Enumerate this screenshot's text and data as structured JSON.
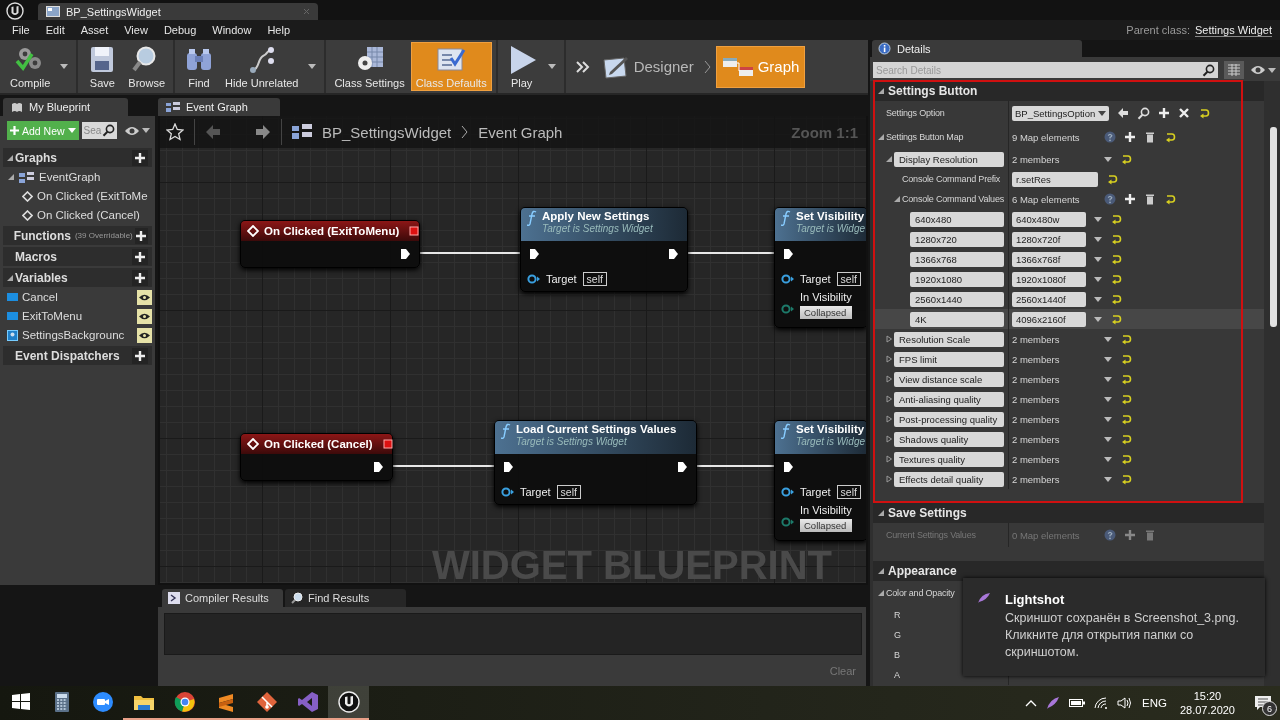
{
  "title_bar": {
    "tab": "BP_SettingsWidget"
  },
  "menu": [
    "File",
    "Edit",
    "Asset",
    "View",
    "Debug",
    "Window",
    "Help"
  ],
  "parent_class": {
    "label": "Parent class:",
    "value": "Settings Widget"
  },
  "toolbar": [
    [
      {
        "kind": "compile",
        "label": "Compile",
        "dropdown": true,
        "selected": false
      }
    ],
    [
      {
        "kind": "save",
        "label": "Save",
        "dropdown": false,
        "selected": false
      },
      {
        "kind": "browse",
        "label": "Browse",
        "dropdown": false,
        "selected": false
      }
    ],
    [
      {
        "kind": "find",
        "label": "Find",
        "dropdown": false,
        "selected": false
      },
      {
        "kind": "hide-unrelated",
        "label": "Hide Unrelated",
        "dropdown": true,
        "selected": false
      }
    ],
    [
      {
        "kind": "class-settings",
        "label": "Class Settings",
        "dropdown": false,
        "selected": false
      },
      {
        "kind": "class-defaults",
        "label": "Class Defaults",
        "dropdown": false,
        "selected": true
      }
    ],
    [
      {
        "kind": "play",
        "label": "Play",
        "dropdown": true,
        "selected": false
      }
    ]
  ],
  "modes": [
    {
      "kind": "designer",
      "label": "Designer",
      "selected": false
    },
    {
      "kind": "graph",
      "label": "Graph",
      "selected": true
    }
  ],
  "my_blueprint": {
    "tab": "My Blueprint",
    "add_button": "Add New",
    "search_placeholder": "Sea",
    "sections": [
      {
        "title": "Graphs",
        "expanded": true,
        "items": [
          {
            "kind": "graph",
            "label": "EventGraph",
            "expanded": true,
            "children": [
              {
                "kind": "event",
                "label": "On Clicked (ExitToMe"
              },
              {
                "kind": "event",
                "label": "On Clicked (Cancel)"
              }
            ]
          }
        ]
      },
      {
        "title": "Functions",
        "note": "(39 Overridable)",
        "expanded": false
      },
      {
        "title": "Macros",
        "expanded": false
      },
      {
        "title": "Variables",
        "expanded": true,
        "items": [
          {
            "kind": "variable",
            "label": "Cancel",
            "exposed": true
          },
          {
            "kind": "variable",
            "label": "ExitToMenu",
            "exposed": true
          },
          {
            "kind": "image-variable",
            "label": "SettingsBackgrounc",
            "exposed": true
          }
        ]
      },
      {
        "title": "Event Dispatchers",
        "expanded": false
      }
    ]
  },
  "graph": {
    "tab": "Event Graph",
    "breadcrumb": [
      "BP_SettingsWidget",
      "Event Graph"
    ],
    "zoom": "Zoom 1:1",
    "watermark": "WIDGET BLUEPRINT",
    "chains": [
      [
        {
          "kind": "event",
          "title": "On Clicked (ExitToMenu)"
        },
        {
          "kind": "function",
          "title": "Apply New Settings",
          "subtitle": "Target is Settings Widget",
          "inputs": [
            {
              "kind": "object",
              "label": "Target",
              "value": "self"
            }
          ]
        },
        {
          "kind": "function",
          "title": "Set Visibility",
          "subtitle": "Target is Widge",
          "inputs": [
            {
              "kind": "object",
              "label": "Target",
              "value": "self"
            },
            {
              "kind": "enum",
              "label": "In Visibility",
              "value": "Collapsed"
            }
          ]
        }
      ],
      [
        {
          "kind": "event",
          "title": "On Clicked (Cancel)"
        },
        {
          "kind": "function",
          "title": "Load Current Settings Values",
          "subtitle": "Target is Settings Widget",
          "inputs": [
            {
              "kind": "object",
              "label": "Target",
              "value": "self"
            }
          ]
        },
        {
          "kind": "function",
          "title": "Set Visibility",
          "subtitle": "Target is Widge",
          "inputs": [
            {
              "kind": "object",
              "label": "Target",
              "value": "self"
            },
            {
              "kind": "enum",
              "label": "In Visibility",
              "value": "Collapsed"
            }
          ]
        }
      ]
    ]
  },
  "results": {
    "tabs": [
      {
        "label": "Compiler Results",
        "selected": true
      },
      {
        "label": "Find Results",
        "selected": false
      }
    ],
    "clear": {
      "label": "Clear",
      "disabled": true
    }
  },
  "details": {
    "tab": "Details",
    "search_placeholder": "Search Details",
    "sections": [
      {
        "title": "Settings Button",
        "expanded": true,
        "rows": [
          {
            "kind": "object",
            "label": "Settings Option",
            "value": "BP_SettingsOption"
          },
          {
            "kind": "map",
            "label": "Settings Button Map",
            "value": "9 Map elements",
            "disabled": false,
            "expanded": true,
            "children": [
              {
                "kind": "struct",
                "label": "Display Resolution",
                "value": "2 members",
                "expanded": true,
                "children": [
                  {
                    "kind": "text",
                    "label": "Console Command Prefix",
                    "value": "r.setRes"
                  },
                  {
                    "kind": "map",
                    "label": "Console Command Values",
                    "value": "6 Map elements",
                    "disabled": false,
                    "expanded": true,
                    "children": [
                      {
                        "kind": "pair",
                        "label": "640x480",
                        "value": "640x480w",
                        "selected": false
                      },
                      {
                        "kind": "pair",
                        "label": "1280x720",
                        "value": "1280x720f",
                        "selected": false
                      },
                      {
                        "kind": "pair",
                        "label": "1366x768",
                        "value": "1366x768f",
                        "selected": false
                      },
                      {
                        "kind": "pair",
                        "label": "1920x1080",
                        "value": "1920x1080f",
                        "selected": false
                      },
                      {
                        "kind": "pair",
                        "label": "2560x1440",
                        "value": "2560x1440f",
                        "selected": false
                      },
                      {
                        "kind": "pair",
                        "label": "4K",
                        "value": "4096x2160f",
                        "selected": true
                      }
                    ]
                  }
                ]
              },
              {
                "kind": "struct",
                "label": "Resolution Scale",
                "value": "2 members",
                "expanded": false
              },
              {
                "kind": "struct",
                "label": "FPS limit",
                "value": "2 members",
                "expanded": false
              },
              {
                "kind": "struct",
                "label": "View distance scale",
                "value": "2 members",
                "expanded": false
              },
              {
                "kind": "struct",
                "label": "Anti-aliasing quality",
                "value": "2 members",
                "expanded": false
              },
              {
                "kind": "struct",
                "label": "Post-processing quality",
                "value": "2 members",
                "expanded": false
              },
              {
                "kind": "struct",
                "label": "Shadows quality",
                "value": "2 members",
                "expanded": false
              },
              {
                "kind": "struct",
                "label": "Textures quality",
                "value": "2 members",
                "expanded": false
              },
              {
                "kind": "struct",
                "label": "Effects detail quality",
                "value": "2 members",
                "expanded": false
              }
            ]
          }
        ]
      },
      {
        "title": "Save Settings",
        "expanded": true,
        "rows": [
          {
            "kind": "map",
            "label": "Current Settings Values",
            "value": "0 Map elements",
            "disabled": true
          }
        ]
      },
      {
        "title": "Appearance",
        "expanded": true,
        "rows": [
          {
            "kind": "group",
            "label": "Color and Opacity",
            "expanded": true,
            "children": [
              {
                "kind": "channel",
                "label": "R"
              },
              {
                "kind": "channel",
                "label": "G"
              },
              {
                "kind": "channel",
                "label": "B"
              },
              {
                "kind": "channel",
                "label": "A"
              }
            ]
          }
        ]
      }
    ]
  },
  "notification": {
    "app": "Lightshot",
    "message": "Скриншот сохранён в Screenshot_3.png. Кликните для открытия папки со скриншотом."
  },
  "taskbar": {
    "apps": [
      {
        "kind": "start",
        "running": false,
        "selected": false
      },
      {
        "kind": "calculator",
        "running": false,
        "selected": false
      },
      {
        "kind": "video",
        "running": false,
        "selected": false
      },
      {
        "kind": "folder",
        "running": true,
        "selected": false
      },
      {
        "kind": "browser",
        "running": true,
        "selected": false
      },
      {
        "kind": "editor",
        "running": true,
        "selected": false
      },
      {
        "kind": "git",
        "running": true,
        "selected": false
      },
      {
        "kind": "ide",
        "running": true,
        "selected": false
      },
      {
        "kind": "engine",
        "running": true,
        "selected": true
      }
    ],
    "language": "ENG",
    "time": "15:20",
    "date": "28.07.2020",
    "notifications": "6"
  }
}
